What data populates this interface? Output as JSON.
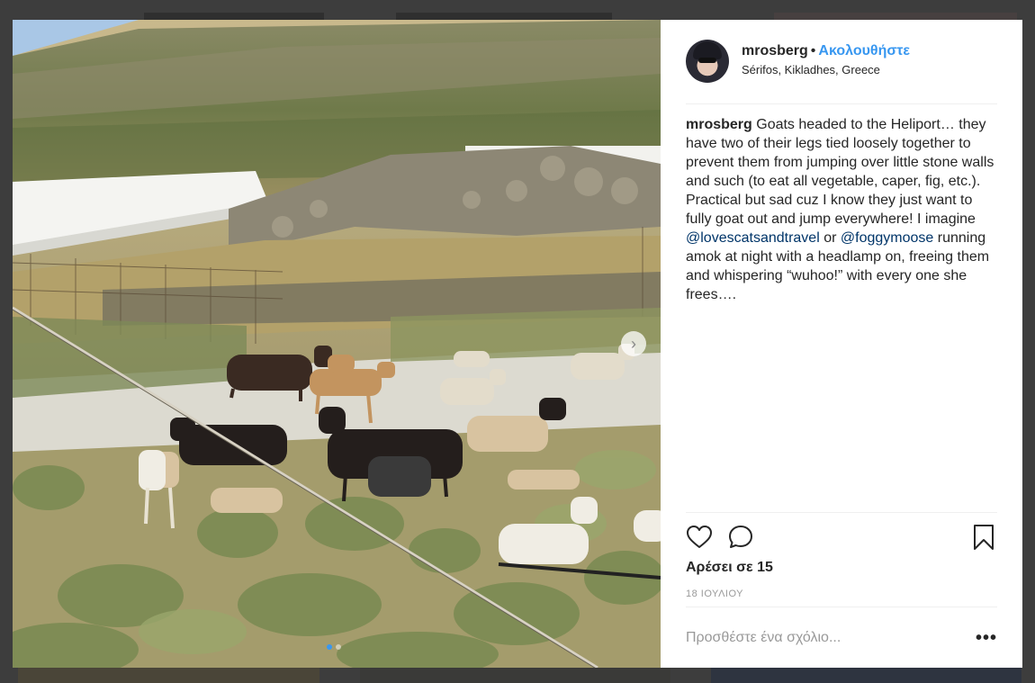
{
  "post": {
    "username": "mrosberg",
    "separator": "•",
    "follow_label": "Ακολουθήστε",
    "location": "Sérifos, Kikladhes, Greece",
    "caption": {
      "author": "mrosberg",
      "text_1": " Goats headed to the Heliport… they have two of their legs tied loosely together to prevent them from jumping over little stone walls and such (to eat all vegetable, caper, fig, etc.). Practical but sad cuz I know they just want to fully goat out and jump everywhere! I imagine ",
      "mention_1": "@lovescatsandtravel",
      "text_2": " or ",
      "mention_2": "@foggymoose",
      "text_3": " running amok at night with a headlamp on, freeing them and whispering “wuhoo!” with every one she frees…."
    },
    "likes_label": "Αρέσει σε 15",
    "date_label": "18 ΙΟΥΛΙΟΥ",
    "comment_placeholder": "Προσθέστε ένα σχόλιο...",
    "more_label": "•••",
    "next_arrow": "›",
    "carousel": {
      "total": 2,
      "current": 1
    }
  },
  "icons": {
    "like": "heart-icon",
    "comment": "comment-bubble-icon",
    "save": "bookmark-icon",
    "next": "chevron-right-icon",
    "more": "more-options-icon"
  },
  "colors": {
    "link": "#3897f0",
    "mention": "#003569",
    "text": "#262626",
    "muted": "#999999",
    "backdrop": "#3d3d3d"
  }
}
